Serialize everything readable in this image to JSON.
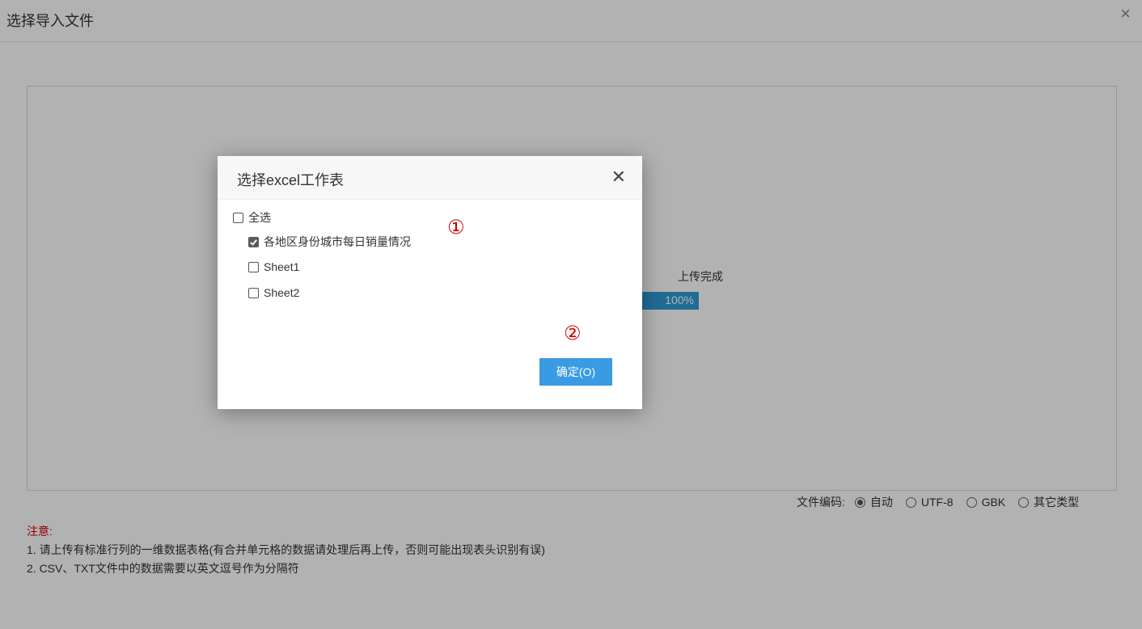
{
  "window": {
    "title": "选择导入文件",
    "close_glyph": "×"
  },
  "upload": {
    "status": "上传完成",
    "progress_text": "100%",
    "progress": 1.0,
    "progress_color": "#2e9bd6"
  },
  "encoding": {
    "label": "文件编码:",
    "options": [
      {
        "label": "自动",
        "selected": true
      },
      {
        "label": "UTF-8",
        "selected": false
      },
      {
        "label": "GBK",
        "selected": false
      },
      {
        "label": "其它类型",
        "selected": false
      }
    ]
  },
  "notes": {
    "title": "注意:",
    "lines": [
      "1. 请上传有标准行列的一维数据表格(有合并单元格的数据请处理后再上传，否则可能出现表头识别有误)",
      "2. CSV、TXT文件中的数据需要以英文逗号作为分隔符"
    ]
  },
  "dialog": {
    "title": "选择excel工作表",
    "close_glyph": "✕",
    "select_all": {
      "label": "全选",
      "checked": false
    },
    "sheets": [
      {
        "label": "各地区身份城市每日销量情况",
        "checked": true
      },
      {
        "label": "Sheet1",
        "checked": false
      },
      {
        "label": "Sheet2",
        "checked": false
      }
    ],
    "annotation_1": "①",
    "annotation_2": "②",
    "ok_label": "确定(O)"
  },
  "colors": {
    "accent": "#3a9be3",
    "note_red": "#d40000",
    "annotation_red": "#d40000"
  }
}
